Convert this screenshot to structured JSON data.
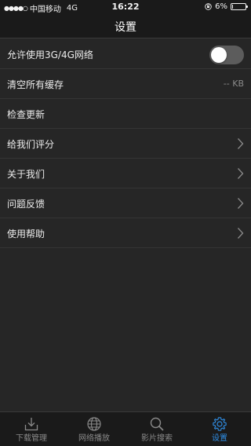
{
  "status_bar": {
    "carrier": "中国移动",
    "network": "4G",
    "time": "16:22",
    "battery_text": "6%",
    "battery_level": 0.06
  },
  "nav": {
    "title": "设置"
  },
  "settings": {
    "allow_network_label": "允许使用3G/4G网络",
    "allow_network_on": false,
    "clear_cache_label": "清空所有缓存",
    "cache_size": "-- KB",
    "check_update_label": "检查更新",
    "rate_us_label": "给我们评分",
    "about_us_label": "关于我们",
    "feedback_label": "问题反馈",
    "help_label": "使用帮助"
  },
  "tabs": [
    {
      "label": "下载管理",
      "icon": "download-tray-icon",
      "active": false
    },
    {
      "label": "网络播放",
      "icon": "globe-icon",
      "active": false
    },
    {
      "label": "影片搜索",
      "icon": "search-icon",
      "active": false
    },
    {
      "label": "设置",
      "icon": "gear-icon",
      "active": true
    }
  ],
  "colors": {
    "accent": "#2f8de4",
    "background": "#262626",
    "bar": "#1a1a1a"
  }
}
